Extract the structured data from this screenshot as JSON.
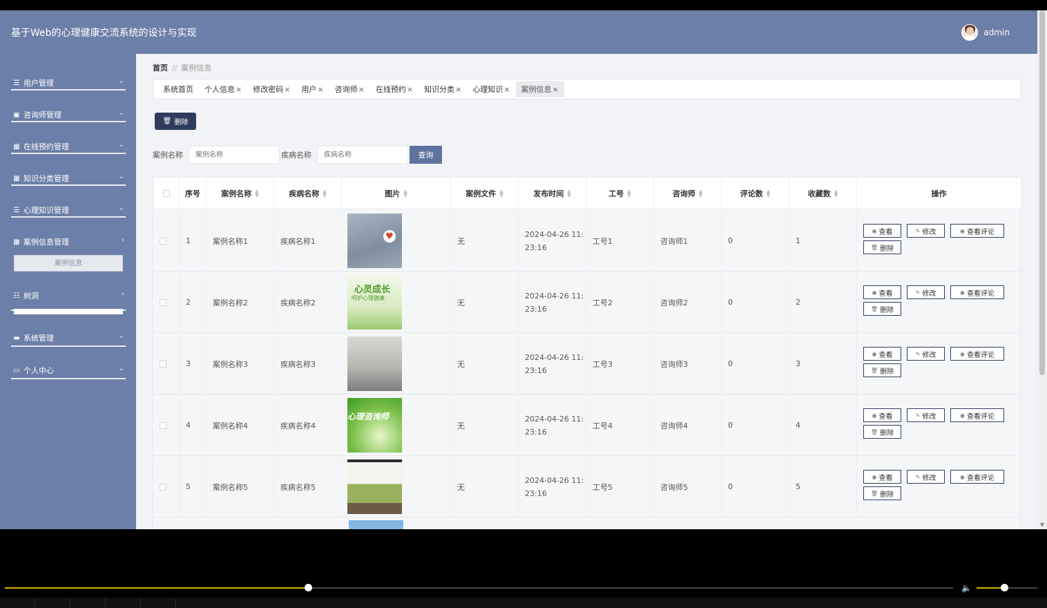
{
  "header": {
    "title": "基于Web的心理健康交流系统的设计与实现",
    "user_name": "admin"
  },
  "sidebar": {
    "items": [
      {
        "label": "用户管理",
        "icon": "list-icon",
        "chevron": "⌄"
      },
      {
        "label": "咨询师管理",
        "icon": "clipboard-icon",
        "chevron": "⌄"
      },
      {
        "label": "在线预约管理",
        "icon": "grid-icon",
        "chevron": "⌄"
      },
      {
        "label": "知识分类管理",
        "icon": "grid-icon",
        "chevron": "⌄"
      },
      {
        "label": "心理知识管理",
        "icon": "list-icon",
        "chevron": "⌄"
      },
      {
        "label": "案例信息管理",
        "icon": "grid-icon",
        "chevron": "‹"
      },
      {
        "label": "树洞",
        "icon": "sliders-icon",
        "chevron": "‹"
      },
      {
        "label": "系统管理",
        "icon": "monitor-icon",
        "chevron": "⌄"
      },
      {
        "label": "个人中心",
        "icon": "card-icon",
        "chevron": "⌄"
      }
    ],
    "submenu": {
      "label": "案例信息"
    }
  },
  "breadcrumb": {
    "home": "首页",
    "separator": "//",
    "current": "案例信息"
  },
  "tabs": [
    {
      "label": "系统首页",
      "closable": false
    },
    {
      "label": "个人信息",
      "closable": true
    },
    {
      "label": "修改密码",
      "closable": true
    },
    {
      "label": "用户",
      "closable": true
    },
    {
      "label": "咨询师",
      "closable": true
    },
    {
      "label": "在线预约",
      "closable": true
    },
    {
      "label": "知识分类",
      "closable": true
    },
    {
      "label": "心理知识",
      "closable": true
    },
    {
      "label": "案例信息",
      "closable": true,
      "active": true
    }
  ],
  "toolbar": {
    "delete_label": "删除"
  },
  "search": {
    "case_name_label": "案例名称",
    "case_name_placeholder": "案例名称",
    "disease_name_label": "疾病名称",
    "disease_name_placeholder": "疾病名称",
    "query_label": "查询"
  },
  "table": {
    "columns": [
      "序号",
      "案例名称",
      "疾病名称",
      "图片",
      "案例文件",
      "发布时间",
      "工号",
      "咨询师",
      "评论数",
      "收藏数",
      "操作"
    ],
    "rows": [
      {
        "index": "1",
        "case_name": "案例名称1",
        "disease_name": "疾病名称1",
        "file": "无",
        "time_line1": "2024-04-26 11:",
        "time_line2": "23:16",
        "job_no": "工号1",
        "counselor": "咨询师1",
        "comments": "0",
        "favorites": "1"
      },
      {
        "index": "2",
        "case_name": "案例名称2",
        "disease_name": "疾病名称2",
        "file": "无",
        "time_line1": "2024-04-26 11:",
        "time_line2": "23:16",
        "job_no": "工号2",
        "counselor": "咨询师2",
        "comments": "0",
        "favorites": "2"
      },
      {
        "index": "3",
        "case_name": "案例名称3",
        "disease_name": "疾病名称3",
        "file": "无",
        "time_line1": "2024-04-26 11:",
        "time_line2": "23:16",
        "job_no": "工号3",
        "counselor": "咨询师3",
        "comments": "0",
        "favorites": "3"
      },
      {
        "index": "4",
        "case_name": "案例名称4",
        "disease_name": "疾病名称4",
        "file": "无",
        "time_line1": "2024-04-26 11:",
        "time_line2": "23:16",
        "job_no": "工号4",
        "counselor": "咨询师4",
        "comments": "0",
        "favorites": "4"
      },
      {
        "index": "5",
        "case_name": "案例名称5",
        "disease_name": "疾病名称5",
        "file": "无",
        "time_line1": "2024-04-26 11:",
        "time_line2": "23:16",
        "job_no": "工号5",
        "counselor": "咨询师5",
        "comments": "0",
        "favorites": "5"
      }
    ],
    "ops": {
      "view": "查看",
      "edit": "修改",
      "view_comments": "查看评论",
      "delete": "删除"
    },
    "thumb_texts": {
      "t2": "心灵成长",
      "t2b": "呵护心理健康",
      "t4": "心理咨询师"
    }
  },
  "player": {
    "progress": 0.32,
    "volume": 0.45
  },
  "colors": {
    "header_bg": "#6c7fa8",
    "dark_button": "#2f3d5c",
    "query_button": "#5f73a0",
    "progress": "#d8b400"
  }
}
